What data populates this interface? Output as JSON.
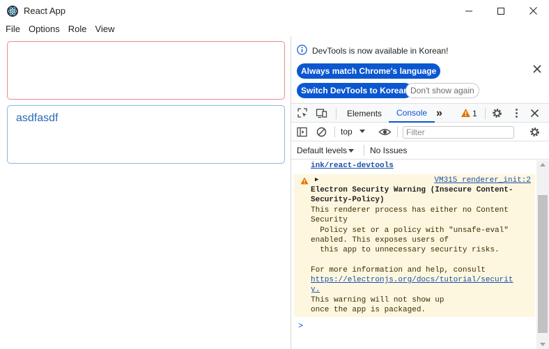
{
  "window": {
    "title": "React App"
  },
  "menu": [
    "File",
    "Options",
    "Role",
    "View"
  ],
  "app": {
    "card2_text": "asdfasdf"
  },
  "devtools": {
    "notice": {
      "text": "DevTools is now available in Korean!",
      "match_language": "Always match Chrome's language",
      "switch_korean": "Switch DevTools to Korean",
      "dont_show": "Don't show again"
    },
    "tabs": {
      "elements": "Elements",
      "console": "Console",
      "more": "»",
      "warning_count": "1"
    },
    "toolbar": {
      "context": "top",
      "filter_placeholder": "Filter"
    },
    "levels": {
      "label": "Default levels",
      "no_issues": "No Issues"
    },
    "console": {
      "prev_link": "ink/react-devtools",
      "source": "VM315 renderer_init:2",
      "lines": [
        "Electron Security Warning (Insecure Content-",
        "Security-Policy)",
        "This renderer process has either no Content",
        "Security",
        "  Policy set or a policy with \"unsafe-eval\"",
        "enabled. This exposes users of",
        "  this app to unnecessary security risks.",
        "For more information and help, consult",
        "https://electronjs.org/docs/tutorial/securit",
        "y.",
        "This warning will not show up",
        "once the app is packaged."
      ],
      "prompt": ">"
    }
  },
  "colors": {
    "accent": "#0b57d0",
    "warning_bg": "#fef7e0",
    "warning_icon": "#e37400"
  }
}
